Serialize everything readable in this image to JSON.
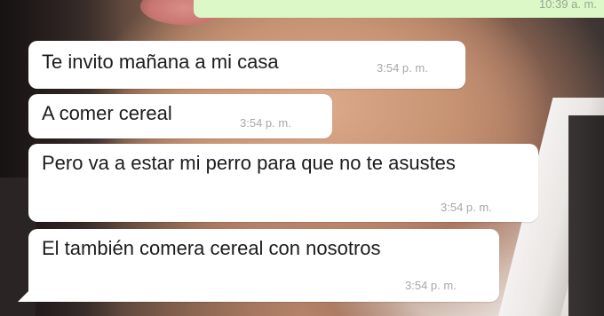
{
  "chat": {
    "outgoing_time": "10:39 a. m.",
    "messages": [
      {
        "text": "Te invito mañana a mi casa",
        "time": "3:54 p. m."
      },
      {
        "text": "A comer cereal",
        "time": "3:54 p. m."
      },
      {
        "text": "Pero va a estar mi perro para que no te asustes",
        "time": "3:54 p. m."
      },
      {
        "text": "El también comera cereal con nosotros",
        "time": "3:54 p. m."
      }
    ]
  },
  "colors": {
    "incoming_bubble": "#ffffff",
    "outgoing_bubble": "#dcf8c6",
    "timestamp": "#a8a8a8"
  }
}
